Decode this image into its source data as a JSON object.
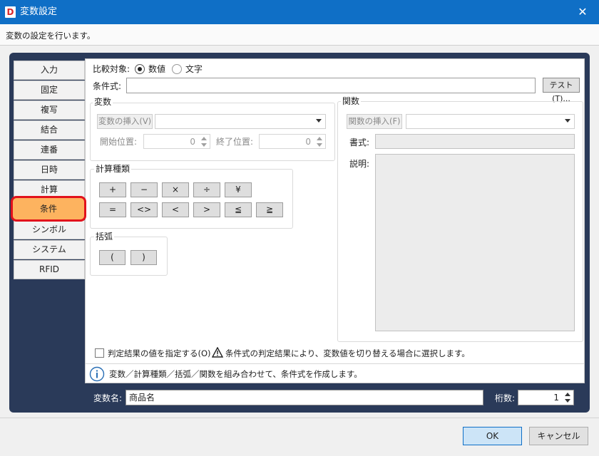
{
  "window": {
    "title": "変数設定",
    "logo_letter": "D",
    "close_glyph": "✕"
  },
  "description": "変数の設定を行います。",
  "tabs": [
    {
      "label": "入力"
    },
    {
      "label": "固定"
    },
    {
      "label": "複写"
    },
    {
      "label": "結合"
    },
    {
      "label": "連番"
    },
    {
      "label": "日時"
    },
    {
      "label": "計算"
    },
    {
      "label": "条件"
    },
    {
      "label": "シンボル"
    },
    {
      "label": "システム"
    },
    {
      "label": "RFID"
    }
  ],
  "compare": {
    "label": "比較対象:",
    "opt_number": "数値",
    "opt_text": "文字",
    "selected": "数値"
  },
  "condition": {
    "label": "条件式:",
    "value": "",
    "test_button": "テスト(T)..."
  },
  "variable": {
    "group_title": "変数",
    "insert_button": "変数の挿入(V)",
    "start_label": "開始位置:",
    "start_value": "0",
    "end_label": "終了位置:",
    "end_value": "0"
  },
  "calc": {
    "group_title": "計算種類",
    "row1": [
      "+",
      "−",
      "×",
      "÷",
      "¥"
    ],
    "row2": [
      "=",
      "<>",
      "<",
      ">",
      "≦",
      "≧"
    ]
  },
  "brackets": {
    "group_title": "括弧",
    "items": [
      "(",
      ")"
    ]
  },
  "function": {
    "group_title": "関数",
    "insert_button": "関数の挿入(F)",
    "format_label": "書式:",
    "desc_label": "説明:"
  },
  "specify_result": {
    "label": "判定結果の値を指定する(O)",
    "checked": false
  },
  "warning_text": "条件式の判定結果により、変数値を切り替える場合に選択します。",
  "info_text": "変数／計算種類／括弧／関数を組み合わせて、条件式を作成します。",
  "var_name": {
    "label": "変数名:",
    "value": "商品名"
  },
  "digits": {
    "label": "桁数:",
    "value": "1"
  },
  "buttons": {
    "ok": "OK",
    "cancel": "キャンセル"
  },
  "colors": {
    "titlebar": "#0f6fc6",
    "frame": "#2a3a59",
    "active_tab": "#fdb35f",
    "active_tab_border": "#e2121c"
  }
}
